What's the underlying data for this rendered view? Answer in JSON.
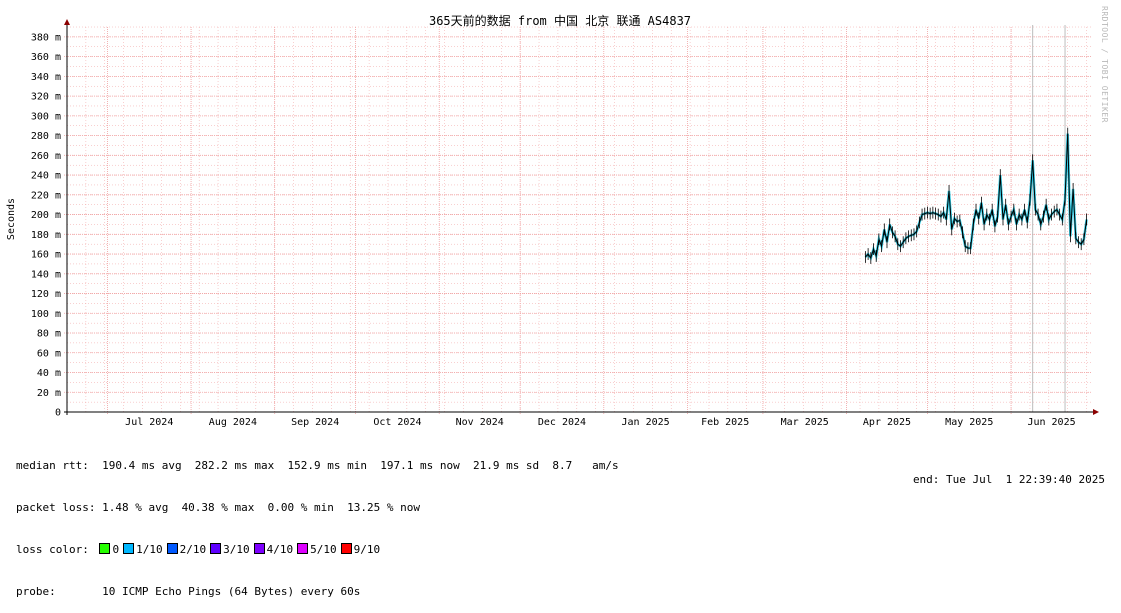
{
  "chart_data": {
    "type": "line",
    "title": "365天前的数据 from 中国 北京 联通 AS4837",
    "ylabel": "Seconds",
    "ylim": [
      0,
      390
    ],
    "y_unit_suffix": "m",
    "y_ticks": [
      0,
      20,
      40,
      60,
      80,
      100,
      120,
      140,
      160,
      180,
      200,
      220,
      240,
      260,
      280,
      300,
      320,
      340,
      360,
      380
    ],
    "y_tick_labels": [
      "0",
      "20 m",
      "40 m",
      "60 m",
      "80 m",
      "100 m",
      "120 m",
      "140 m",
      "160 m",
      "180 m",
      "200 m",
      "220 m",
      "240 m",
      "260 m",
      "280 m",
      "300 m",
      "320 m",
      "340 m",
      "360 m",
      "380 m"
    ],
    "x_range": [
      "2024-06-16",
      "2025-07-01"
    ],
    "x_month_labels": [
      {
        "date": "2024-07-01",
        "label": "Jul 2024"
      },
      {
        "date": "2024-08-01",
        "label": "Aug 2024"
      },
      {
        "date": "2024-09-01",
        "label": "Sep 2024"
      },
      {
        "date": "2024-10-01",
        "label": "Oct 2024"
      },
      {
        "date": "2024-11-01",
        "label": "Nov 2024"
      },
      {
        "date": "2024-12-01",
        "label": "Dec 2024"
      },
      {
        "date": "2025-01-01",
        "label": "Jan 2025"
      },
      {
        "date": "2025-02-01",
        "label": "Feb 2025"
      },
      {
        "date": "2025-03-01",
        "label": "Mar 2025"
      },
      {
        "date": "2025-04-01",
        "label": "Apr 2025"
      },
      {
        "date": "2025-05-01",
        "label": "May 2025"
      },
      {
        "date": "2025-06-01",
        "label": "Jun 2025"
      }
    ],
    "grid": true,
    "series": [
      {
        "points": [
          [
            "2025-04-08",
            157
          ],
          [
            "2025-04-09",
            160
          ],
          [
            "2025-04-10",
            156
          ],
          [
            "2025-04-11",
            165
          ],
          [
            "2025-04-12",
            158
          ],
          [
            "2025-04-13",
            175
          ],
          [
            "2025-04-14",
            168
          ],
          [
            "2025-04-15",
            185
          ],
          [
            "2025-04-16",
            172
          ],
          [
            "2025-04-17",
            190
          ],
          [
            "2025-04-18",
            182
          ],
          [
            "2025-04-19",
            178
          ],
          [
            "2025-04-20",
            170
          ],
          [
            "2025-04-21",
            168
          ],
          [
            "2025-04-22",
            172
          ],
          [
            "2025-04-23",
            176
          ],
          [
            "2025-04-24",
            178
          ],
          [
            "2025-04-25",
            179
          ],
          [
            "2025-04-26",
            180
          ],
          [
            "2025-04-27",
            183
          ],
          [
            "2025-04-28",
            192
          ],
          [
            "2025-04-29",
            200
          ],
          [
            "2025-04-30",
            201
          ],
          [
            "2025-05-01",
            202
          ],
          [
            "2025-05-02",
            201
          ],
          [
            "2025-05-03",
            202
          ],
          [
            "2025-05-04",
            201
          ],
          [
            "2025-05-05",
            200
          ],
          [
            "2025-05-06",
            198
          ],
          [
            "2025-05-07",
            202
          ],
          [
            "2025-05-08",
            195
          ],
          [
            "2025-05-09",
            224
          ],
          [
            "2025-05-10",
            185
          ],
          [
            "2025-05-11",
            196
          ],
          [
            "2025-05-12",
            193
          ],
          [
            "2025-05-13",
            194
          ],
          [
            "2025-05-14",
            182
          ],
          [
            "2025-05-15",
            168
          ],
          [
            "2025-05-16",
            166
          ],
          [
            "2025-05-17",
            166
          ],
          [
            "2025-05-18",
            190
          ],
          [
            "2025-05-19",
            205
          ],
          [
            "2025-05-20",
            196
          ],
          [
            "2025-05-21",
            212
          ],
          [
            "2025-05-22",
            190
          ],
          [
            "2025-05-23",
            200
          ],
          [
            "2025-05-24",
            195
          ],
          [
            "2025-05-25",
            205
          ],
          [
            "2025-05-26",
            188
          ],
          [
            "2025-05-27",
            198
          ],
          [
            "2025-05-28",
            240
          ],
          [
            "2025-05-29",
            195
          ],
          [
            "2025-05-30",
            210
          ],
          [
            "2025-05-31",
            190
          ],
          [
            "2025-06-01",
            198
          ],
          [
            "2025-06-02",
            205
          ],
          [
            "2025-06-03",
            190
          ],
          [
            "2025-06-04",
            200
          ],
          [
            "2025-06-05",
            195
          ],
          [
            "2025-06-06",
            205
          ],
          [
            "2025-06-07",
            192
          ],
          [
            "2025-06-08",
            215
          ],
          [
            "2025-06-09",
            255
          ],
          [
            "2025-06-10",
            205
          ],
          [
            "2025-06-11",
            200
          ],
          [
            "2025-06-12",
            190
          ],
          [
            "2025-06-13",
            198
          ],
          [
            "2025-06-14",
            210
          ],
          [
            "2025-06-15",
            195
          ],
          [
            "2025-06-16",
            200
          ],
          [
            "2025-06-17",
            203
          ],
          [
            "2025-06-18",
            205
          ],
          [
            "2025-06-19",
            200
          ],
          [
            "2025-06-20",
            195
          ],
          [
            "2025-06-21",
            215
          ],
          [
            "2025-06-22",
            282
          ],
          [
            "2025-06-23",
            178
          ],
          [
            "2025-06-24",
            226
          ],
          [
            "2025-06-25",
            176
          ],
          [
            "2025-06-26",
            172
          ],
          [
            "2025-06-27",
            170
          ],
          [
            "2025-06-28",
            175
          ],
          [
            "2025-06-29",
            195
          ]
        ]
      }
    ],
    "loss_spikes": [
      {
        "date": "2025-06-09",
        "value": 392
      },
      {
        "date": "2025-06-21",
        "value": 392
      }
    ],
    "colors": {
      "line": "#000000",
      "median_shade": "#00c0e0",
      "grid": "#f0a0a0",
      "spike": "#bdbdbd",
      "axis": "#000000",
      "arrow": "#8b0000"
    }
  },
  "stats": {
    "median_rtt": "median rtt:  190.4 ms avg  282.2 ms max  152.9 ms min  197.1 ms now  21.9 ms sd  8.7   am/s",
    "packet_loss": "packet loss: 1.48 % avg  40.38 % max  0.00 % min  13.25 % now",
    "loss_color_label": "loss color: ",
    "loss_colors": [
      {
        "label": "0",
        "color": "#26ff00"
      },
      {
        "label": "1/10",
        "color": "#00b8ff"
      },
      {
        "label": "2/10",
        "color": "#0059ff"
      },
      {
        "label": "3/10",
        "color": "#5e00ff"
      },
      {
        "label": "4/10",
        "color": "#7e00ff"
      },
      {
        "label": "5/10",
        "color": "#dd00ff"
      },
      {
        "label": "9/10",
        "color": "#ff0000"
      }
    ],
    "probe": "probe:       10 ICMP Echo Pings (64 Bytes) every 60s",
    "end": "end: Tue Jul  1 22:39:40 2025"
  },
  "watermark": "RRDTOOL / TOBI OETIKER"
}
